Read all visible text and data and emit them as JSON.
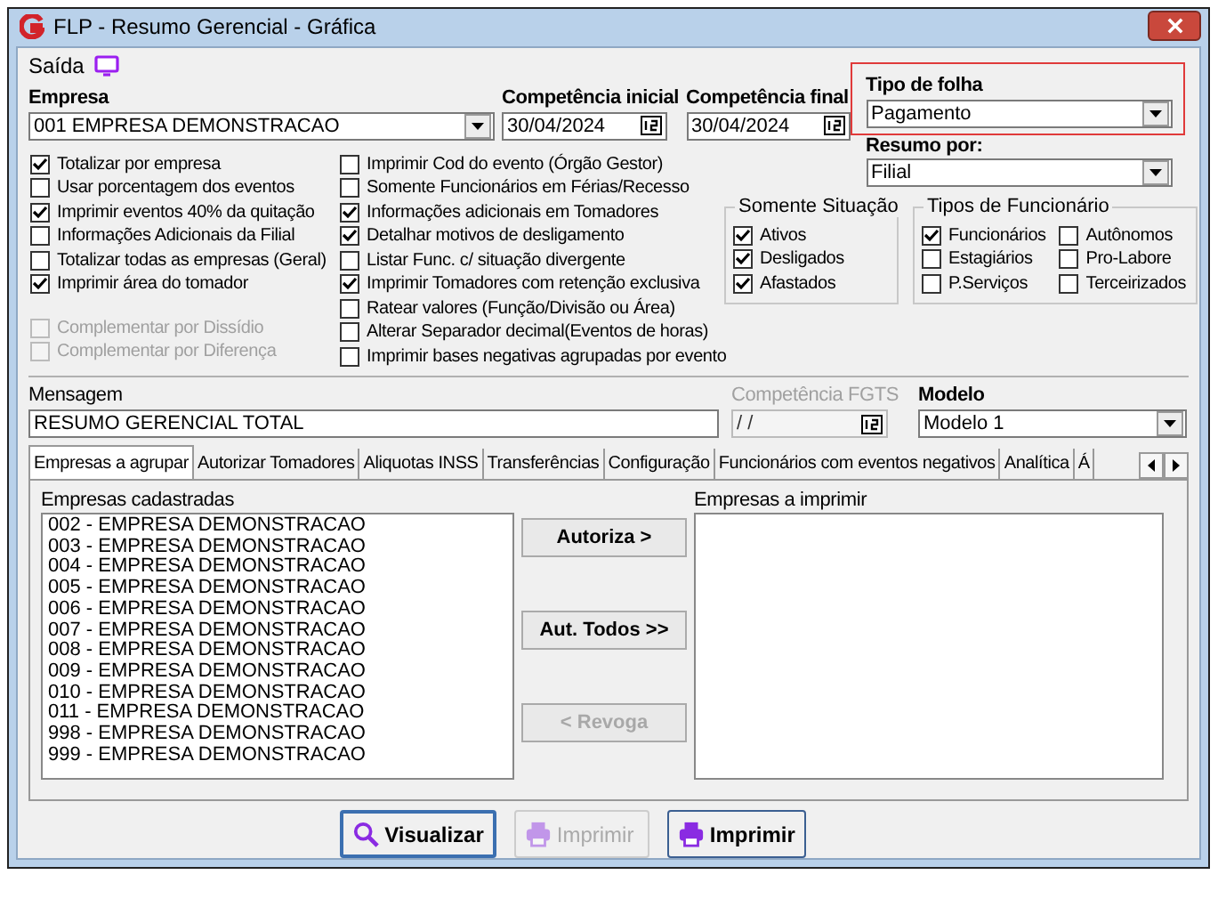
{
  "window": {
    "title": "FLP - Resumo Gerencial - Gráfica"
  },
  "menu": [
    {
      "label": "Saída"
    }
  ],
  "empresa": {
    "label": "Empresa",
    "value": "001 EMPRESA DEMONSTRACAO"
  },
  "competencia_inicial": {
    "label": "Competência inicial",
    "value": "30/04/2024"
  },
  "competencia_final": {
    "label": "Competência final",
    "value": "30/04/2024"
  },
  "tipo_de_folha": {
    "label": "Tipo de folha",
    "value": "Pagamento"
  },
  "resumo_por": {
    "label": "Resumo por:",
    "value": "Filial"
  },
  "options_left": [
    {
      "label": "Totalizar por empresa",
      "checked": true,
      "disabled": false
    },
    {
      "label": "Usar porcentagem dos eventos",
      "checked": false,
      "disabled": false
    },
    {
      "label": "Imprimir eventos 40% da quitação",
      "checked": true,
      "disabled": false
    },
    {
      "label": "Informações Adicionais da Filial",
      "checked": false,
      "disabled": false
    },
    {
      "label": "Totalizar todas as empresas (Geral)",
      "checked": false,
      "disabled": false
    },
    {
      "label": "Imprimir área do tomador",
      "checked": true,
      "disabled": false
    }
  ],
  "options_left_bottom": [
    {
      "label": "Complementar por Dissídio",
      "checked": false,
      "disabled": true
    },
    {
      "label": "Complementar por Diferença",
      "checked": false,
      "disabled": true
    }
  ],
  "options_middle": [
    {
      "label": "Imprimir Cod do evento (Órgão Gestor)",
      "checked": false
    },
    {
      "label": "Somente Funcionários em Férias/Recesso",
      "checked": false
    },
    {
      "label": "Informações adicionais em Tomadores",
      "checked": true
    },
    {
      "label": "Detalhar motivos de desligamento",
      "checked": true
    },
    {
      "label": "Listar Func. c/ situação divergente",
      "checked": false
    },
    {
      "label": "Imprimir Tomadores com retenção exclusiva",
      "checked": true
    },
    {
      "label": "Ratear valores (Função/Divisão ou Área)",
      "checked": false
    },
    {
      "label": "Alterar Separador decimal(Eventos de horas)",
      "checked": false
    },
    {
      "label": "Imprimir bases negativas agrupadas por evento",
      "checked": false
    }
  ],
  "somente_situacao": {
    "title": "Somente Situação",
    "items": [
      {
        "label": "Ativos",
        "checked": true
      },
      {
        "label": "Desligados",
        "checked": true
      },
      {
        "label": "Afastados",
        "checked": true
      }
    ]
  },
  "tipos_de_funcionario": {
    "title": "Tipos de Funcionário",
    "items": [
      {
        "label": "Funcionários",
        "checked": true
      },
      {
        "label": "Autônomos",
        "checked": false
      },
      {
        "label": "Estagiários",
        "checked": false
      },
      {
        "label": "Pro-Labore",
        "checked": false
      },
      {
        "label": "P.Serviços",
        "checked": false
      },
      {
        "label": "Terceirizados",
        "checked": false
      }
    ]
  },
  "mensagem": {
    "label": "Mensagem",
    "value": "RESUMO GERENCIAL TOTAL"
  },
  "competencia_fgts": {
    "label": "Competência FGTS",
    "value": " / /",
    "disabled": true
  },
  "modelo": {
    "label": "Modelo",
    "value": "Modelo 1"
  },
  "tabs": [
    {
      "label": "Empresas a agrupar",
      "selected": true
    },
    {
      "label": "Autorizar Tomadores",
      "selected": false
    },
    {
      "label": "Aliquotas INSS",
      "selected": false
    },
    {
      "label": "Transferências",
      "selected": false
    },
    {
      "label": "Configuração",
      "selected": false
    },
    {
      "label": "Funcionários com eventos negativos",
      "selected": false
    },
    {
      "label": "Analítica",
      "selected": false
    },
    {
      "label": "Á",
      "selected": false
    }
  ],
  "empresas_cadastradas": {
    "label": "Empresas cadastradas",
    "items": [
      "002 - EMPRESA DEMONSTRACAO",
      "003 - EMPRESA DEMONSTRACAO",
      "004 - EMPRESA DEMONSTRACAO",
      "005 - EMPRESA DEMONSTRACAO",
      "006 - EMPRESA DEMONSTRACAO",
      "007 - EMPRESA DEMONSTRACAO",
      "008 - EMPRESA DEMONSTRACAO",
      "009 - EMPRESA DEMONSTRACAO",
      "010 - EMPRESA DEMONSTRACAO",
      "011 - EMPRESA DEMONSTRACAO",
      "998 - EMPRESA DEMONSTRACAO",
      "999 - EMPRESA DEMONSTRACAO"
    ]
  },
  "transfer_buttons": [
    {
      "label": "Autoriza >",
      "disabled": false
    },
    {
      "label": "Aut. Todos >>",
      "disabled": false
    },
    {
      "label": "< Revoga",
      "disabled": true
    }
  ],
  "empresas_a_imprimir": {
    "label": "Empresas a imprimir"
  },
  "buttons": [
    {
      "label": "Visualizar",
      "kind": "preview",
      "disabled": false
    },
    {
      "label": "Imprimir",
      "kind": "print",
      "disabled": true
    },
    {
      "label": "Imprimir",
      "kind": "print",
      "disabled": false
    }
  ]
}
